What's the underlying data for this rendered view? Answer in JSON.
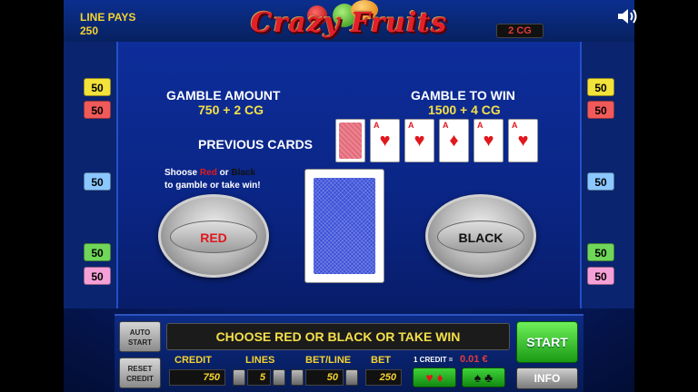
{
  "header": {
    "line_pays_label": "LINE PAYS",
    "line_pays_value": "250",
    "logo_text": "Crazy Fruits",
    "cg_badge": "2 CG"
  },
  "left_lines": [
    "50",
    "50",
    "50",
    "50",
    "50"
  ],
  "right_lines": [
    "50",
    "50",
    "50",
    "50",
    "50"
  ],
  "line_colors": [
    "#f2e23a",
    "#f05a5a",
    "#8ac8ff",
    "#6fd65a",
    "#f5a0d8"
  ],
  "gamble": {
    "amount_label": "GAMBLE AMOUNT",
    "amount_value": "750 + 2 CG",
    "win_label": "GAMBLE TO WIN",
    "win_value": "1500 + 4 CG",
    "previous_cards_label": "PREVIOUS CARDS",
    "previous_cards": [
      {
        "rank": "A",
        "suit": "♥"
      },
      {
        "rank": "A",
        "suit": "♥"
      },
      {
        "rank": "A",
        "suit": "♦"
      },
      {
        "rank": "A",
        "suit": "♥"
      },
      {
        "rank": "A",
        "suit": "♥"
      }
    ],
    "instruction_pre": "Shoose ",
    "instruction_red": "Red",
    "instruction_or": " or ",
    "instruction_black": "Black",
    "instruction_post": "to gamble or take win!",
    "red_button": "RED",
    "black_button": "BLACK"
  },
  "controls": {
    "auto_start": "AUTO START",
    "reset_credit": "RESET CREDIT",
    "message": "CHOOSE RED OR BLACK OR TAKE WIN",
    "start": "START",
    "info": "INFO",
    "credit_label": "CREDIT",
    "credit_value": "750",
    "lines_label": "LINES",
    "lines_value": "5",
    "betline_label": "BET/LINE",
    "betline_value": "50",
    "bet_label": "BET",
    "bet_value": "250",
    "credit_rate_label": "1 CREDIT =",
    "credit_rate_value": "0.01 €",
    "red_suits": "♥ ♦",
    "black_suits": "♠ ♣"
  }
}
